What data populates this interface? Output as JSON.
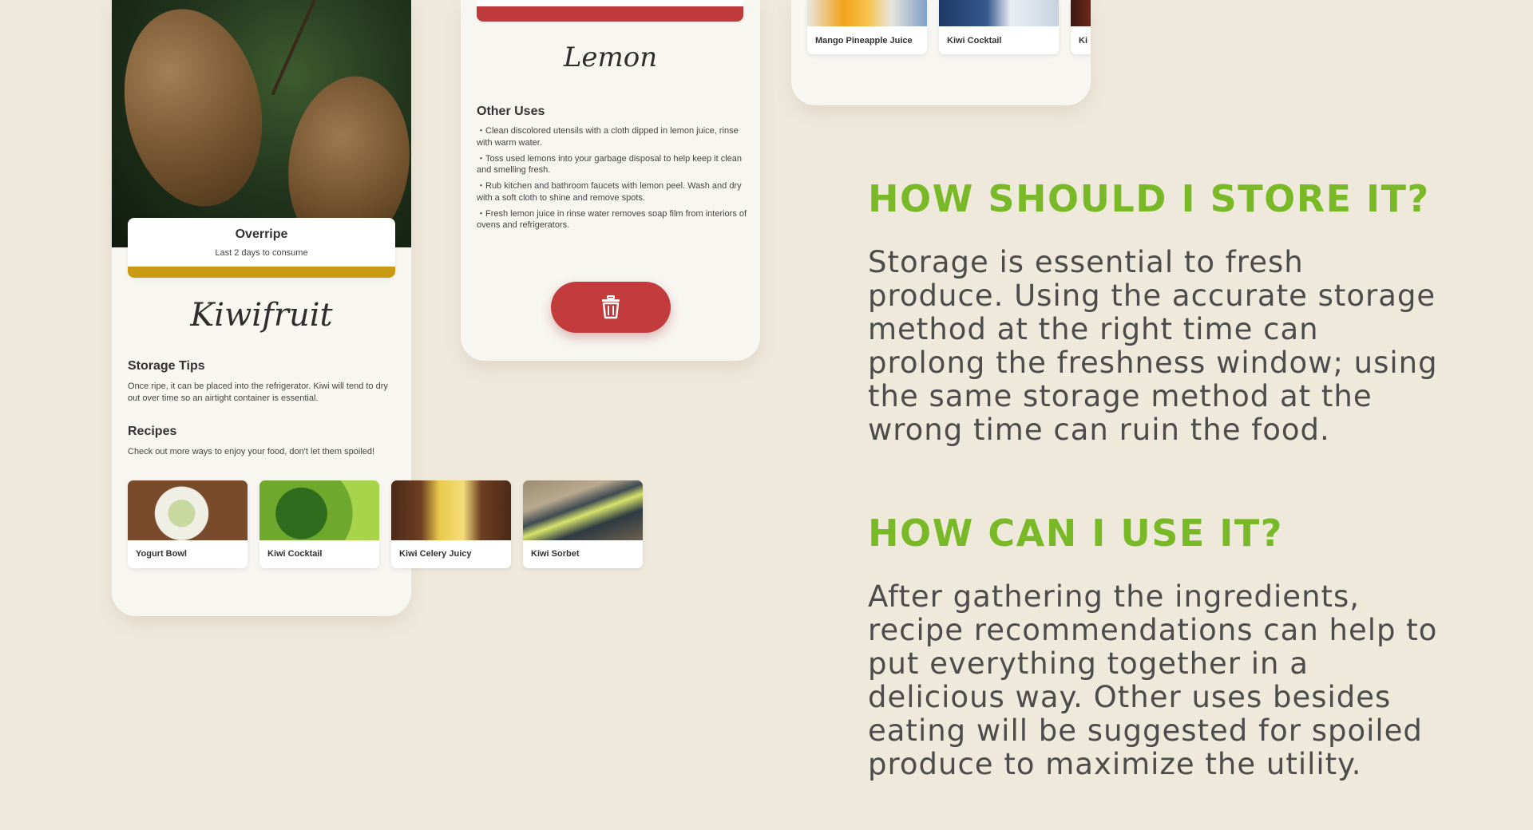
{
  "colors": {
    "background": "#efe9dc",
    "accent_green": "#79b928",
    "overripe_bar": "#c99a12",
    "spoiled_red": "#bf3a3c"
  },
  "kiwi_screen": {
    "status": {
      "title": "Overripe",
      "subtitle": "Last 2 days to consume"
    },
    "fruit_name": "Kiwifruit",
    "storage_tips": {
      "heading": "Storage Tips",
      "text": "Once ripe, it can be placed into the refrigerator. Kiwi will tend to dry out over time so an airtight container is essential."
    },
    "recipes": {
      "heading": "Recipes",
      "text": "Check out more ways to enjoy your food, don't let them spoiled!",
      "items": [
        {
          "label": "Yogurt Bowl"
        },
        {
          "label": "Kiwi Cocktail"
        },
        {
          "label": "Kiwi Celery Juicy"
        },
        {
          "label": "Kiwi Sorbet"
        }
      ]
    }
  },
  "lemon_screen": {
    "fruit_name": "Lemon",
    "other_uses": {
      "heading": "Other Uses",
      "items": [
        "・Clean discolored utensils with a cloth dipped in lemon juice, rinse with warm water.",
        "・Toss used lemons into your garbage disposal to help keep it clean and smelling fresh.",
        "・Rub kitchen and bathroom faucets with lemon peel. Wash and dry with a soft cloth to shine and remove spots.",
        "・Fresh lemon juice in rinse water removes soap film from interiors of ovens and refrigerators."
      ]
    },
    "delete_icon": "trash-icon"
  },
  "juice_screen": {
    "items": [
      {
        "label": "Mango Pineapple Juice"
      },
      {
        "label": "Kiwi Cocktail"
      },
      {
        "label": "Ki"
      }
    ]
  },
  "copy": {
    "store": {
      "heading": "HOW SHOULD I STORE IT?",
      "body": "Storage is essential to fresh produce. Using the accurate storage method at the right time can prolong the freshness window; using the same storage method at the wrong time can ruin the food."
    },
    "use": {
      "heading": "HOW CAN I USE IT?",
      "body": "After gathering the ingredients, recipe recommendations can help to put everything together in a delicious way. Other uses besides eating will be suggested for spoiled produce to maximize the utility."
    }
  }
}
